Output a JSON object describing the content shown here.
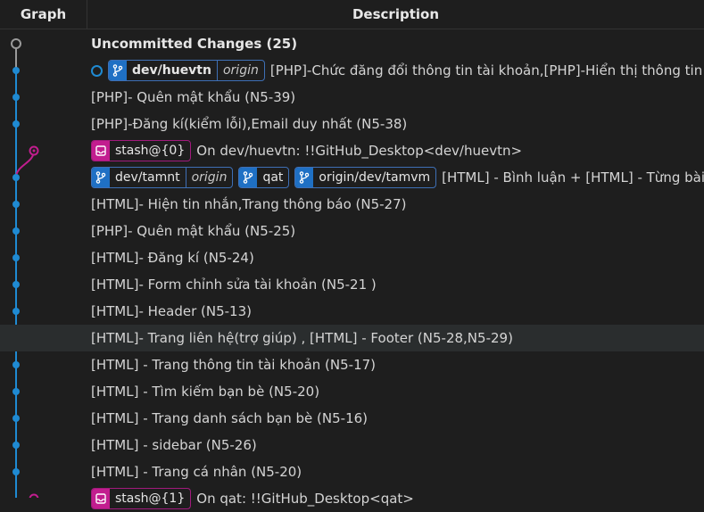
{
  "header": {
    "graph": "Graph",
    "description": "Description"
  },
  "rows": [
    {
      "text": "Uncommitted Changes (25)"
    },
    {
      "refs": [
        {
          "name": "dev/huevtn",
          "remote": "origin"
        }
      ],
      "text": "[PHP]-Chức đăng đổi thông tin tài khoản,[PHP]-Hiển thị thông tin tài khoản"
    },
    {
      "text": "[PHP]- Quên mật khẩu (N5-39)"
    },
    {
      "text": "[PHP]-Đăng kí(kiểm lỗi),Email duy nhất (N5-38)"
    },
    {
      "stash": "stash@{0}",
      "text": "On dev/huevtn: !!GitHub_Desktop<dev/huevtn>"
    },
    {
      "refs": [
        {
          "name": "dev/tamnt",
          "remote": "origin"
        },
        {
          "name": "qat"
        },
        {
          "name": "origin/dev/tamvm"
        }
      ],
      "text": "[HTML] - Bình luận + [HTML] - Từng bài viết"
    },
    {
      "text": "[HTML]- Hiện tin nhắn,Trang thông báo (N5-27)"
    },
    {
      "text": "[PHP]- Quên mật khẩu (N5-25)"
    },
    {
      "text": "[HTML]- Đăng kí (N5-24)"
    },
    {
      "text": "[HTML]- Form chỉnh sửa tài khoản (N5-21 )"
    },
    {
      "text": "[HTML]- Header (N5-13)"
    },
    {
      "text": "[HTML]- Trang liên hệ(trợ giúp) , [HTML] - Footer (N5-28,N5-29)"
    },
    {
      "text": "[HTML] - Trang thông tin tài khoản (N5-17)"
    },
    {
      "text": "[HTML] - Tìm kiếm bạn bè (N5-20)"
    },
    {
      "text": "[HTML] - Trang danh sách bạn bè (N5-16)"
    },
    {
      "text": "[HTML] - sidebar (N5-26)"
    },
    {
      "text": "[HTML] - Trang cá nhân (N5-20)"
    },
    {
      "stash": "stash@{1}",
      "text": "On qat: !!GitHub_Desktop<qat>"
    }
  ],
  "colors": {
    "branch": "#1f8ad2",
    "stash": "#c21d8f",
    "uncommitted": "#9a9a9a"
  },
  "icons": {
    "branch": "git-branch-icon",
    "stash": "stash-icon"
  }
}
